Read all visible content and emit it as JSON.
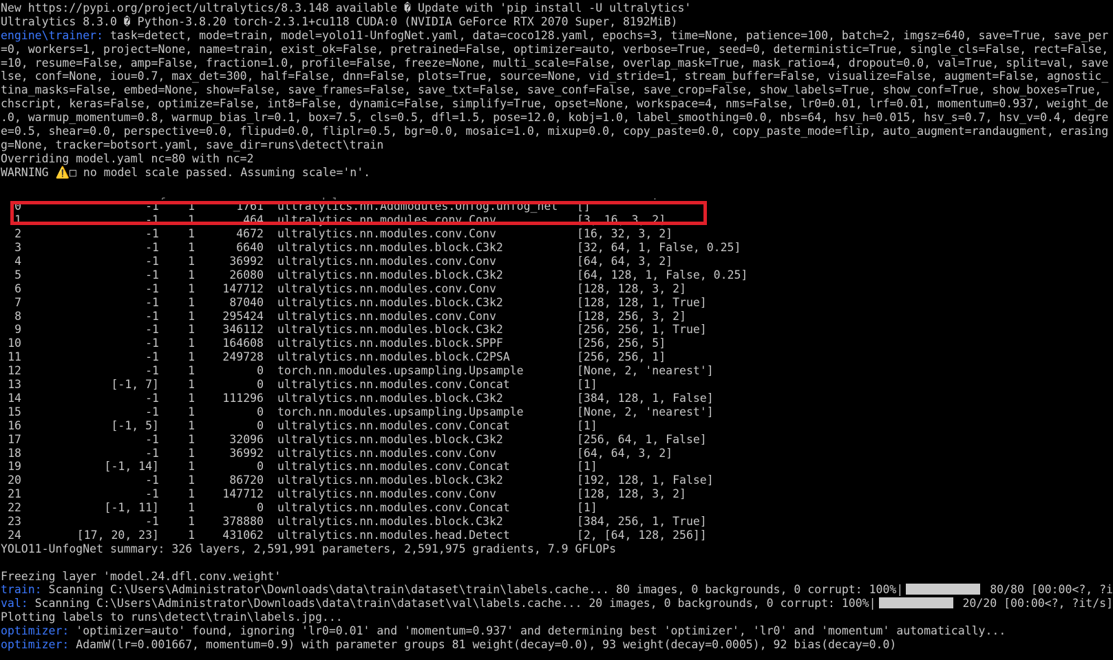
{
  "header_lines": [
    {
      "text": "New https://pypi.org/project/ultralytics/8.3.148 available � Update with 'pip install -U ultralytics'"
    },
    {
      "text": "Ultralytics 8.3.0 � Python-3.8.20 torch-2.3.1+cu118 CUDA:0 (NVIDIA GeForce RTX 2070 Super, 8192MiB)"
    },
    {
      "prefix": "engine\\trainer:",
      "text": " task=detect, mode=train, model=yolo11-UnfogNet.yaml, data=coco128.yaml, epochs=3, time=None, patience=100, batch=2, imgsz=640, save=True, save_per"
    },
    {
      "text": "=0, workers=1, project=None, name=train, exist_ok=False, pretrained=False, optimizer=auto, verbose=True, seed=0, deterministic=True, single_cls=False, rect=False,"
    },
    {
      "text": "=10, resume=False, amp=False, fraction=1.0, profile=False, freeze=None, multi_scale=False, overlap_mask=True, mask_ratio=4, dropout=0.0, val=True, split=val, save"
    },
    {
      "text": "lse, conf=None, iou=0.7, max_det=300, half=False, dnn=False, plots=True, source=None, vid_stride=1, stream_buffer=False, visualize=False, augment=False, agnostic_"
    },
    {
      "text": "tina_masks=False, embed=None, show=False, save_frames=False, save_txt=False, save_conf=False, save_crop=False, show_labels=True, show_conf=True, show_boxes=True,"
    },
    {
      "text": "chscript, keras=False, optimize=False, int8=False, dynamic=False, simplify=True, opset=None, workspace=4, nms=False, lr0=0.01, lrf=0.01, momentum=0.937, weight_de"
    },
    {
      "text": ".0, warmup_momentum=0.8, warmup_bias_lr=0.1, box=7.5, cls=0.5, dfl=1.5, pose=12.0, kobj=1.0, label_smoothing=0.0, nbs=64, hsv_h=0.015, hsv_s=0.7, hsv_v=0.4, degre"
    },
    {
      "text": "e=0.5, shear=0.0, perspective=0.0, flipud=0.0, fliplr=0.5, bgr=0.0, mosaic=1.0, mixup=0.0, copy_paste=0.0, copy_paste_mode=flip, auto_augment=randaugment, erasing"
    },
    {
      "text": "g=None, tracker=botsort.yaml, save_dir=runs\\detect\\train"
    },
    {
      "text": "Overriding model.yaml nc=80 with nc=2"
    },
    {
      "text": "WARNING ⚠️□ no model scale passed. Assuming scale='n'."
    },
    {
      "text": ""
    }
  ],
  "table_header_cut": {
    "from": "from",
    "n": "n",
    "params": "params",
    "module": "module",
    "args": "arguments"
  },
  "layers": [
    {
      "idx": "0",
      "from": "-1",
      "n": "1",
      "params": "1761",
      "module": "ultralytics.nn.Addmodules.Unfog.unfog_net",
      "args": "[]"
    },
    {
      "idx": "1",
      "from": "-1",
      "n": "1",
      "params": "464",
      "module": "ultralytics.nn.modules.conv.Conv",
      "args": "[3, 16, 3, 2]"
    },
    {
      "idx": "2",
      "from": "-1",
      "n": "1",
      "params": "4672",
      "module": "ultralytics.nn.modules.conv.Conv",
      "args": "[16, 32, 3, 2]"
    },
    {
      "idx": "3",
      "from": "-1",
      "n": "1",
      "params": "6640",
      "module": "ultralytics.nn.modules.block.C3k2",
      "args": "[32, 64, 1, False, 0.25]"
    },
    {
      "idx": "4",
      "from": "-1",
      "n": "1",
      "params": "36992",
      "module": "ultralytics.nn.modules.conv.Conv",
      "args": "[64, 64, 3, 2]"
    },
    {
      "idx": "5",
      "from": "-1",
      "n": "1",
      "params": "26080",
      "module": "ultralytics.nn.modules.block.C3k2",
      "args": "[64, 128, 1, False, 0.25]"
    },
    {
      "idx": "6",
      "from": "-1",
      "n": "1",
      "params": "147712",
      "module": "ultralytics.nn.modules.conv.Conv",
      "args": "[128, 128, 3, 2]"
    },
    {
      "idx": "7",
      "from": "-1",
      "n": "1",
      "params": "87040",
      "module": "ultralytics.nn.modules.block.C3k2",
      "args": "[128, 128, 1, True]"
    },
    {
      "idx": "8",
      "from": "-1",
      "n": "1",
      "params": "295424",
      "module": "ultralytics.nn.modules.conv.Conv",
      "args": "[128, 256, 3, 2]"
    },
    {
      "idx": "9",
      "from": "-1",
      "n": "1",
      "params": "346112",
      "module": "ultralytics.nn.modules.block.C3k2",
      "args": "[256, 256, 1, True]"
    },
    {
      "idx": "10",
      "from": "-1",
      "n": "1",
      "params": "164608",
      "module": "ultralytics.nn.modules.block.SPPF",
      "args": "[256, 256, 5]"
    },
    {
      "idx": "11",
      "from": "-1",
      "n": "1",
      "params": "249728",
      "module": "ultralytics.nn.modules.block.C2PSA",
      "args": "[256, 256, 1]"
    },
    {
      "idx": "12",
      "from": "-1",
      "n": "1",
      "params": "0",
      "module": "torch.nn.modules.upsampling.Upsample",
      "args": "[None, 2, 'nearest']"
    },
    {
      "idx": "13",
      "from": "[-1, 7]",
      "n": "1",
      "params": "0",
      "module": "ultralytics.nn.modules.conv.Concat",
      "args": "[1]"
    },
    {
      "idx": "14",
      "from": "-1",
      "n": "1",
      "params": "111296",
      "module": "ultralytics.nn.modules.block.C3k2",
      "args": "[384, 128, 1, False]"
    },
    {
      "idx": "15",
      "from": "-1",
      "n": "1",
      "params": "0",
      "module": "torch.nn.modules.upsampling.Upsample",
      "args": "[None, 2, 'nearest']"
    },
    {
      "idx": "16",
      "from": "[-1, 5]",
      "n": "1",
      "params": "0",
      "module": "ultralytics.nn.modules.conv.Concat",
      "args": "[1]"
    },
    {
      "idx": "17",
      "from": "-1",
      "n": "1",
      "params": "32096",
      "module": "ultralytics.nn.modules.block.C3k2",
      "args": "[256, 64, 1, False]"
    },
    {
      "idx": "18",
      "from": "-1",
      "n": "1",
      "params": "36992",
      "module": "ultralytics.nn.modules.conv.Conv",
      "args": "[64, 64, 3, 2]"
    },
    {
      "idx": "19",
      "from": "[-1, 14]",
      "n": "1",
      "params": "0",
      "module": "ultralytics.nn.modules.conv.Concat",
      "args": "[1]"
    },
    {
      "idx": "20",
      "from": "-1",
      "n": "1",
      "params": "86720",
      "module": "ultralytics.nn.modules.block.C3k2",
      "args": "[192, 128, 1, False]"
    },
    {
      "idx": "21",
      "from": "-1",
      "n": "1",
      "params": "147712",
      "module": "ultralytics.nn.modules.conv.Conv",
      "args": "[128, 128, 3, 2]"
    },
    {
      "idx": "22",
      "from": "[-1, 11]",
      "n": "1",
      "params": "0",
      "module": "ultralytics.nn.modules.conv.Concat",
      "args": "[1]"
    },
    {
      "idx": "23",
      "from": "-1",
      "n": "1",
      "params": "378880",
      "module": "ultralytics.nn.modules.block.C3k2",
      "args": "[384, 256, 1, True]"
    },
    {
      "idx": "24",
      "from": "[17, 20, 23]",
      "n": "1",
      "params": "431062",
      "module": "ultralytics.nn.modules.head.Detect",
      "args": "[2, [64, 128, 256]]"
    }
  ],
  "footer_lines": [
    {
      "text": "YOLO11-UnfogNet summary: 326 layers, 2,591,991 parameters, 2,591,975 gradients, 7.9 GFLOPs"
    },
    {
      "text": ""
    },
    {
      "text": "Freezing layer 'model.24.dfl.conv.weight'"
    },
    {
      "prefix": "train:",
      "text": " Scanning C:\\Users\\Administrator\\Downloads\\data\\train\\dataset\\train\\labels.cache... 80 images, 0 backgrounds, 0 corrupt: 100%|",
      "bar": true,
      "tail": " 80/80 [00:00<?, ?i"
    },
    {
      "prefix": "val:",
      "text": " Scanning C:\\Users\\Administrator\\Downloads\\data\\train\\dataset\\val\\labels.cache... 20 images, 0 backgrounds, 0 corrupt: 100%|",
      "bar": true,
      "tail": " 20/20 [00:00<?, ?it/s]"
    },
    {
      "text": "Plotting labels to runs\\detect\\train\\labels.jpg..."
    },
    {
      "prefix": "optimizer:",
      "text": " 'optimizer=auto' found, ignoring 'lr0=0.01' and 'momentum=0.937' and determining best 'optimizer', 'lr0' and 'momentum' automatically..."
    },
    {
      "prefix": "optimizer:",
      "text": " AdamW(lr=0.001667, momentum=0.9) with parameter groups 81 weight(decay=0.0), 93 weight(decay=0.0005), 92 bias(decay=0.0)"
    }
  ],
  "colors": {
    "background": "#000000",
    "text": "#c8c8c8",
    "prefix": "#3b78ff",
    "highlight": "#e0202a",
    "progress_bar": "#cccccc"
  }
}
